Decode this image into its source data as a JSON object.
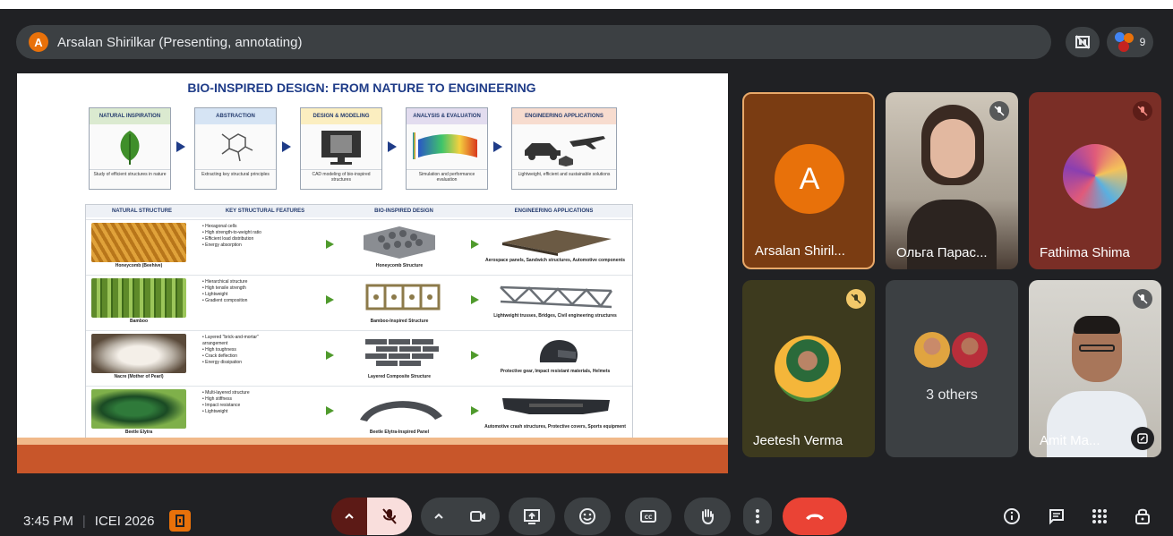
{
  "presenter_bar": {
    "avatar_letter": "A",
    "label": "Arsalan Shirilkar (Presenting, annotating)"
  },
  "top_right": {
    "participant_count": "9"
  },
  "slide": {
    "title": "BIO-INSPIRED DESIGN: FROM NATURE TO ENGINEERING",
    "stages": [
      {
        "heading": "NATURAL INSPIRATION",
        "caption": "Study of efficient structures in nature",
        "color": "#dbead0"
      },
      {
        "heading": "ABSTRACTION",
        "caption": "Extracting key structural principles",
        "color": "#d6e4f4"
      },
      {
        "heading": "DESIGN & MODELING",
        "caption": "CAD modeling of bio-inspired structures",
        "color": "#fbeec0"
      },
      {
        "heading": "ANALYSIS & EVALUATION",
        "caption": "Simulation and performance evaluation",
        "color": "#e2dcef"
      },
      {
        "heading": "ENGINEERING APPLICATIONS",
        "caption": "Lightweight, efficient and sustainable solutions",
        "color": "#f7dccf"
      }
    ],
    "table_headers": [
      "NATURAL STRUCTURE",
      "KEY STRUCTURAL FEATURES",
      "BIO-INSPIRED DESIGN",
      "ENGINEERING APPLICATIONS"
    ],
    "rows": [
      {
        "structure": "Honeycomb (Beehive)",
        "features": [
          "• Hexagonal cells",
          "• High strength-to-weight ratio",
          "• Efficient load distribution",
          "• Energy absorption"
        ],
        "design": "Honeycomb Structure",
        "applications": "Aerospace panels, Sandwich structures, Automotive components"
      },
      {
        "structure": "Bamboo",
        "features": [
          "• Hierarchical structure",
          "• High tensile strength",
          "• Lightweight",
          "• Gradient composition"
        ],
        "design": "Bamboo-Inspired Structure",
        "applications": "Lightweight trusses, Bridges, Civil engineering structures"
      },
      {
        "structure": "Nacre (Mother of Pearl)",
        "features": [
          "• Layered \"brick-and-mortar\"",
          "  arrangement",
          "• High toughness",
          "• Crack deflection",
          "• Energy dissipation"
        ],
        "design": "Layered Composite Structure",
        "applications": "Protective gear, Impact resistant materials, Helmets"
      },
      {
        "structure": "Beetle Elytra",
        "features": [
          "• Multi-layered structure",
          "• High stiffness",
          "• Impact resistance",
          "• Lightweight"
        ],
        "design": "Beetle Elytra-Inspired Panel",
        "applications": "Automotive crash structures, Protective covers, Sports equipment"
      }
    ]
  },
  "tiles": {
    "arsalan": {
      "name": "Arsalan Shiril...",
      "avatar_letter": "A"
    },
    "olga": {
      "name": "Ольга Парас..."
    },
    "fathima": {
      "name": "Fathima Shima"
    },
    "jeetesh": {
      "name": "Jeetesh Verma"
    },
    "others": {
      "label": "3 others"
    },
    "amit": {
      "name": "Amit Ma..."
    }
  },
  "bottom_bar": {
    "time": "3:45 PM",
    "meeting_name": "ICEI 2026"
  },
  "colors": {
    "background": "#202124",
    "end_call": "#ea4335",
    "mic_off": "#f9dedc",
    "accent_orange": "#e8710a"
  }
}
